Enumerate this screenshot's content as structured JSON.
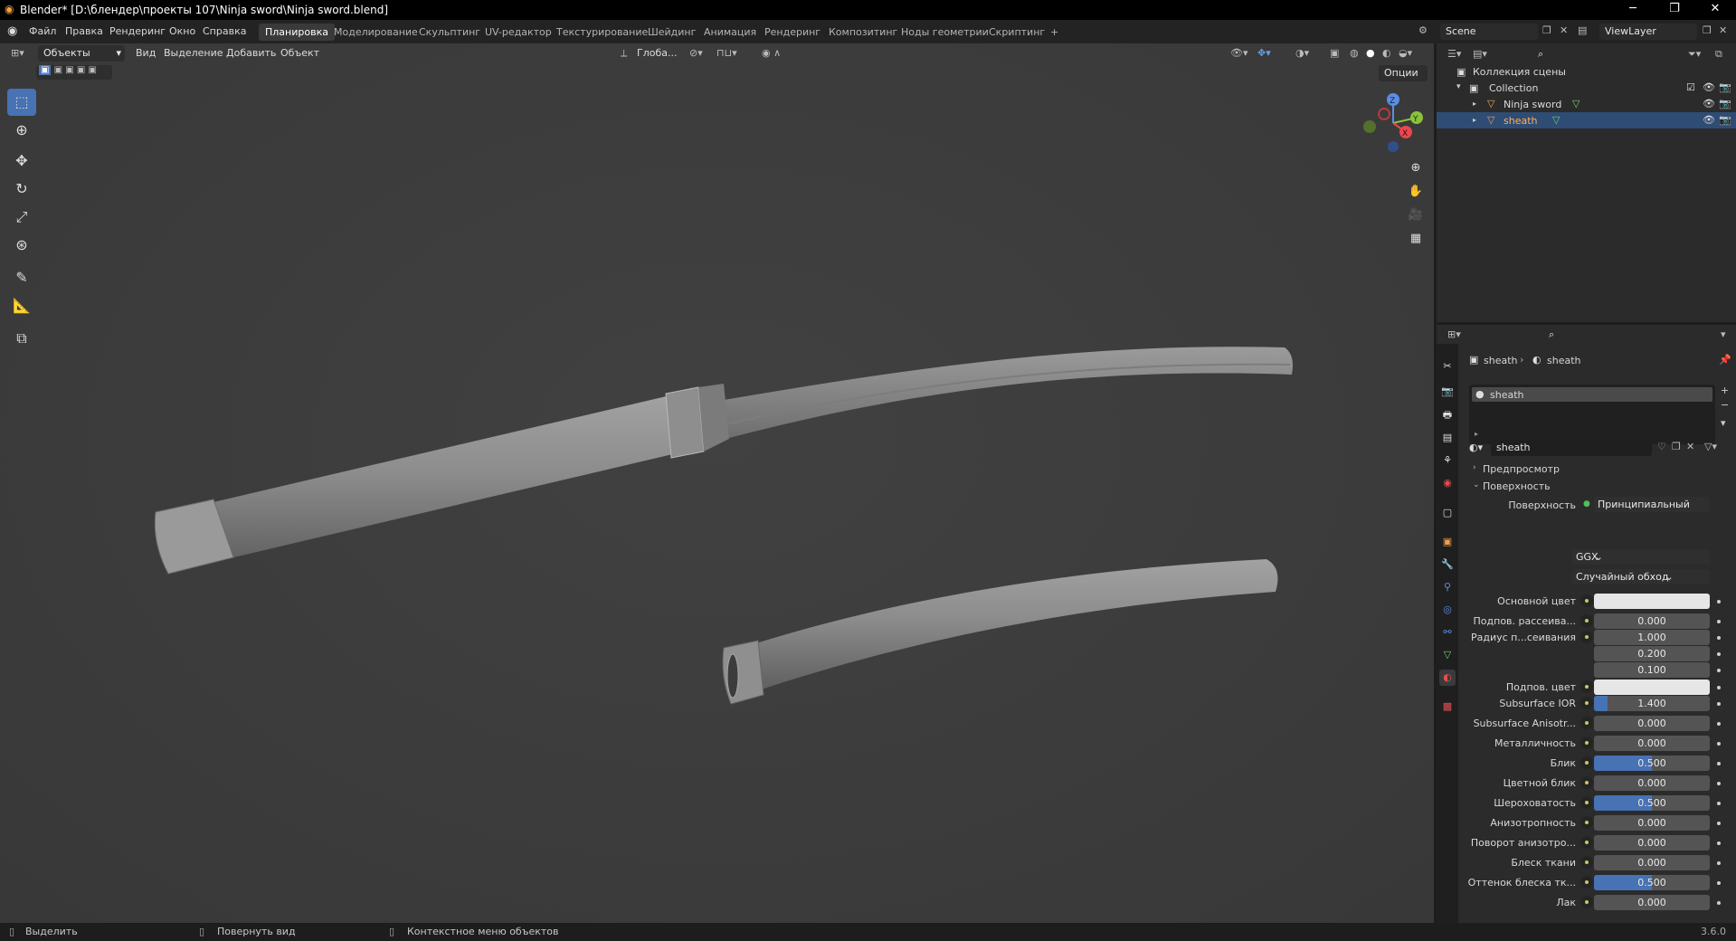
{
  "titlebar": {
    "title": "Blender* [D:\\блендер\\проекты 107\\Ninja sword\\Ninja sword.blend]",
    "minimize": "─",
    "restore": "❐",
    "close": "✕"
  },
  "menu": [
    "Файл",
    "Правка",
    "Рендеринг",
    "Окно",
    "Справка"
  ],
  "workspaces": [
    "Планировка",
    "Моделирование",
    "Скульптинг",
    "UV-редактор",
    "Текстурирование",
    "Шейдинг",
    "Анимация",
    "Рендеринг",
    "Композитинг",
    "Ноды геометрии",
    "Скриптинг"
  ],
  "workspace_add": "+",
  "scene": "Scene",
  "view_layer": "ViewLayer",
  "viewport_header": {
    "mode": "Объекты",
    "menus": [
      "Вид",
      "Выделение",
      "Добавить",
      "Объект"
    ],
    "transform_orientation": "Глоба...",
    "options": "Опции"
  },
  "gizmo": {
    "z": "Z",
    "y": "Y",
    "x": "X"
  },
  "outliner": {
    "root": "Коллекция сцены",
    "collection": "Collection",
    "items": [
      {
        "name": "Ninja sword",
        "selected": false
      },
      {
        "name": "sheath",
        "selected": true
      }
    ]
  },
  "properties": {
    "breadcrumb_object": "sheath",
    "breadcrumb_material": "sheath",
    "slot": "sheath",
    "material_name": "sheath",
    "panels": {
      "preview": "Предпросмотр",
      "surface": "Поверхность"
    },
    "surface_label": "Поверхность",
    "surface_value": "Принципиальный BSDF",
    "distribution": "GGX",
    "subsurface_method": "Случайный обход",
    "rows": [
      {
        "label": "Основной цвет",
        "value": "",
        "color": "#e6e6e6",
        "fill": 0
      },
      {
        "label": "Подпов. рассеива...",
        "value": "0.000",
        "fill": 0
      },
      {
        "label": "Радиус п...сеивания",
        "value": "1.000",
        "fill": 0
      },
      {
        "label": "",
        "value": "0.200",
        "fill": 0
      },
      {
        "label": "",
        "value": "0.100",
        "fill": 0
      },
      {
        "label": "Подпов. цвет",
        "value": "",
        "color": "#e6e6e6",
        "fill": 0
      },
      {
        "label": "Subsurface IOR",
        "value": "1.400",
        "fill": 0.12
      },
      {
        "label": "Subsurface Anisotr...",
        "value": "0.000",
        "fill": 0
      },
      {
        "label": "Металличность",
        "value": "0.000",
        "fill": 0
      },
      {
        "label": "Блик",
        "value": "0.500",
        "fill": 0.5
      },
      {
        "label": "Цветной блик",
        "value": "0.000",
        "fill": 0
      },
      {
        "label": "Шероховатость",
        "value": "0.500",
        "fill": 0.5
      },
      {
        "label": "Анизотропность",
        "value": "0.000",
        "fill": 0
      },
      {
        "label": "Поворот анизотро...",
        "value": "0.000",
        "fill": 0
      },
      {
        "label": "Блеск ткани",
        "value": "0.000",
        "fill": 0
      },
      {
        "label": "Оттенок блеска тк...",
        "value": "0.500",
        "fill": 0.5
      },
      {
        "label": "Лак",
        "value": "0.000",
        "fill": 0
      }
    ]
  },
  "statusbar": {
    "select": "Выделить",
    "rotate": "Повернуть вид",
    "context": "Контекстное меню объектов",
    "version": "3.6.0"
  },
  "colors": {
    "accent": "#4772b3",
    "selected_row": "#2f4c74"
  }
}
